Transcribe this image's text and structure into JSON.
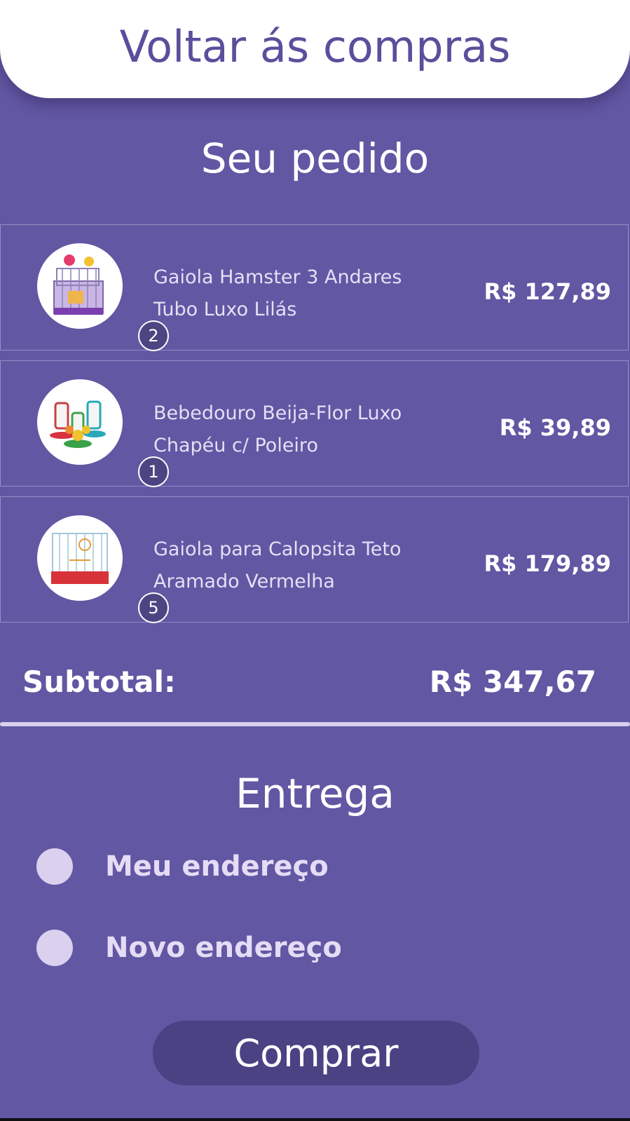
{
  "header": {
    "back_label": "Voltar ás compras"
  },
  "order": {
    "title": "Seu pedido",
    "items": [
      {
        "name": "Gaiola Hamster 3 Andares\nTubo Luxo Lilás",
        "price": "R$ 127,89",
        "quantity": "2",
        "image_icon": "hamster-cage-icon"
      },
      {
        "name": "Bebedouro Beija-Flor Luxo\n Chapéu c/ Poleiro",
        "price": "R$ 39,89",
        "quantity": "1",
        "image_icon": "hummingbird-feeder-icon"
      },
      {
        "name": "Gaiola para Calopsita Teto\nAramado Vermelha",
        "price": "R$ 179,89",
        "quantity": "5",
        "image_icon": "bird-cage-icon"
      }
    ],
    "subtotal_label": "Subtotal:",
    "subtotal_value": "R$ 347,67"
  },
  "delivery": {
    "title": "Entrega",
    "options": [
      {
        "label": "Meu endereço"
      },
      {
        "label": "Novo endereço"
      }
    ]
  },
  "actions": {
    "buy_label": "Comprar"
  },
  "colors": {
    "background": "#6157a3",
    "accent_dark": "#4a4283",
    "radio": "#dbd1ef"
  }
}
